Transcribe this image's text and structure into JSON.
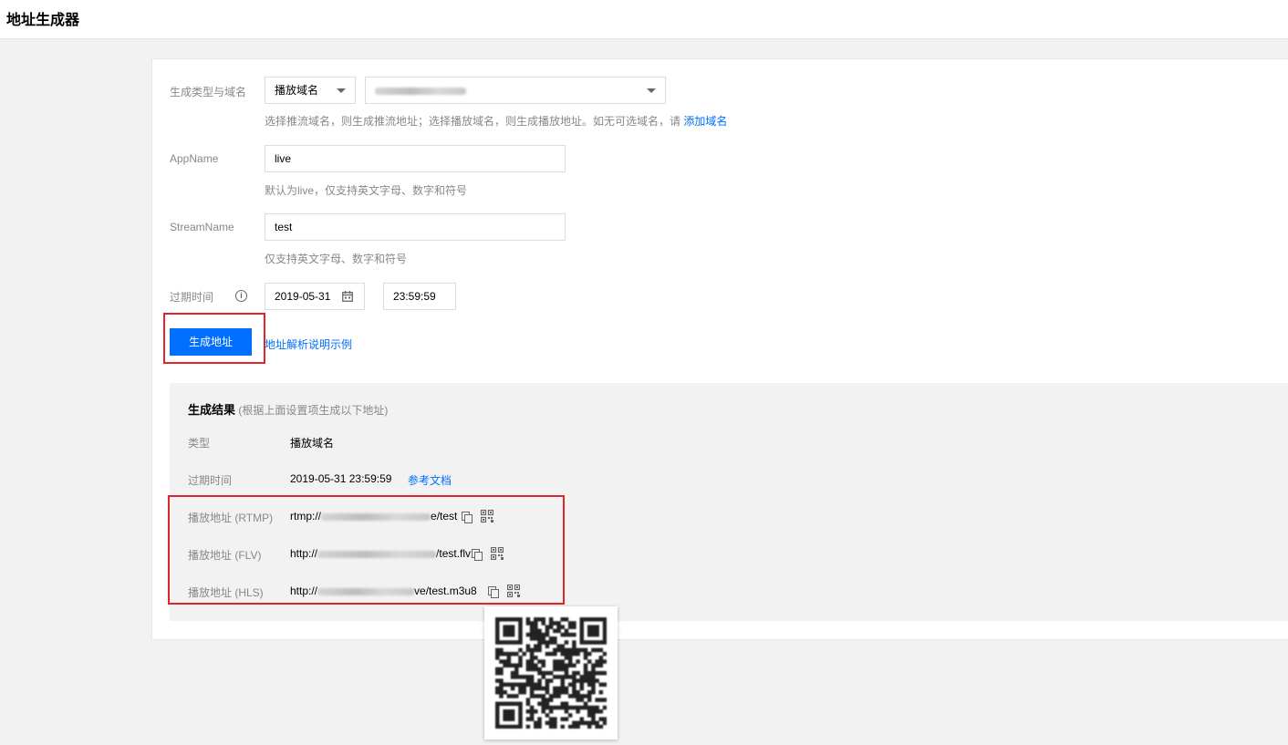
{
  "header": {
    "title": "地址生成器"
  },
  "form": {
    "type_domain_label": "生成类型与域名",
    "type_select_value": "播放域名",
    "type_hint_prefix": "选择推流域名，则生成推流地址；选择播放域名，则生成播放地址。如无可选域名，请",
    "type_hint_link": "添加域名",
    "appname_label": "AppName",
    "appname_value": "live",
    "appname_hint": "默认为live，仅支持英文字母、数字和符号",
    "streamname_label": "StreamName",
    "streamname_value": "test",
    "streamname_hint": "仅支持英文字母、数字和符号",
    "expire_label": "过期时间",
    "expire_date": "2019-05-31",
    "expire_time": "23:59:59",
    "generate_button": "生成地址",
    "example_link": "地址解析说明示例"
  },
  "result": {
    "title": "生成结果",
    "subtitle": "(根据上面设置项生成以下地址)",
    "rows": [
      {
        "label": "类型",
        "value": "播放域名"
      },
      {
        "label": "过期时间",
        "value": "2019-05-31 23:59:59",
        "link": "参考文档"
      }
    ],
    "urls": [
      {
        "label": "播放地址 (RTMP)",
        "prefix": "rtmp://",
        "suffix": "e/test"
      },
      {
        "label": "播放地址 (FLV)",
        "prefix": "http://",
        "suffix": "/test.flv"
      },
      {
        "label": "播放地址 (HLS)",
        "prefix": "http://",
        "suffix": "ve/test.m3u8"
      }
    ]
  },
  "colors": {
    "primary": "#006eff",
    "highlight": "#e1242b"
  },
  "icons": {
    "calendar": "calendar-icon",
    "info": "info-icon",
    "copy": "copy-icon",
    "qrcode": "qrcode-icon"
  }
}
